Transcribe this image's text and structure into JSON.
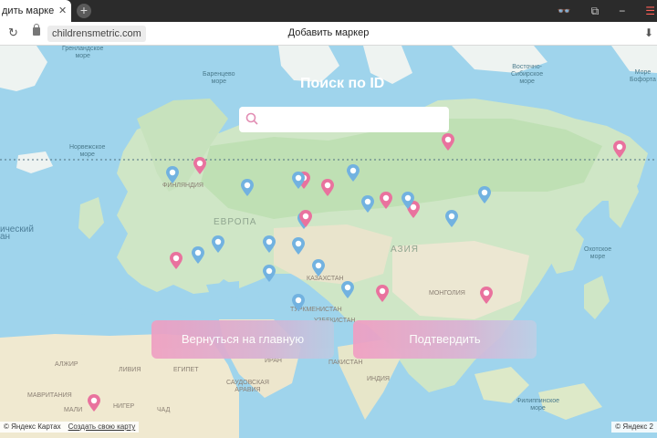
{
  "browser": {
    "tab_title": "дить маркер",
    "tab_close": "✕",
    "new_tab": "+",
    "url": "childrensmetric.com",
    "page_title": "Добавить маркер"
  },
  "search": {
    "title": "Поиск по ID",
    "placeholder": ""
  },
  "buttons": {
    "back": "Вернуться на главную",
    "confirm": "Подтвердить"
  },
  "footer": {
    "yandex_left": "© Яндекс Картах",
    "create_map": "Создать свою карту",
    "yandex_right": "© Яндекс 2"
  },
  "map_labels": {
    "barents": "Баренцево\nморе",
    "greenland": "Гренландское\nморе",
    "norwegian": "Норвежское\nморе",
    "europe": "ЕВРОПА",
    "asia": "АЗИЯ",
    "atlantic": "ический\nан",
    "okhotsk": "Охотское\nморе",
    "beaufort": "Море\nБофорта",
    "east_siberian": "Восточно-\nСибирское\nморе",
    "philippine": "Филиппинское\nморе",
    "kazakhstan": "КАЗАХСТАН",
    "mongolia": "МОНГОЛИЯ",
    "iran": "ИРАН",
    "egypt": "ЕГИПЕТ",
    "algeria": "АЛЖИР",
    "libya": "ЛИВИЯ",
    "mali": "МАЛИ",
    "niger": "НИГЕР",
    "chad": "ЧАД",
    "saudi": "САУДОВСКАЯ\nАРАВИЯ",
    "mauritania": "МАВРИТАНИЯ",
    "finland": "ФИНЛЯНДИЯ",
    "pakistan": "ПАКИСТАН",
    "india": "ИНДИЯ",
    "turkmenistan": "ТУРКМЕНИСТАН",
    "uzbekistan": "УЗБЕКИСТАН"
  },
  "colors": {
    "pin_pink": "#e9729e",
    "pin_blue": "#72b2e0",
    "water": "#9fd4ec"
  },
  "markers": [
    {
      "color": "pink"
    },
    {
      "color": "blue"
    },
    {
      "color": "blue"
    },
    {
      "color": "pink"
    },
    {
      "color": "pink"
    },
    {
      "color": "blue"
    },
    {
      "color": "blue"
    },
    {
      "color": "pink"
    },
    {
      "color": "pink"
    },
    {
      "color": "blue"
    },
    {
      "color": "blue"
    },
    {
      "color": "pink"
    },
    {
      "color": "blue"
    },
    {
      "color": "pink"
    },
    {
      "color": "blue"
    },
    {
      "color": "blue"
    },
    {
      "color": "blue"
    },
    {
      "color": "blue"
    },
    {
      "color": "blue"
    },
    {
      "color": "blue"
    },
    {
      "color": "blue"
    },
    {
      "color": "pink"
    },
    {
      "color": "pink"
    },
    {
      "color": "blue"
    },
    {
      "color": "pink"
    },
    {
      "color": "blue"
    },
    {
      "color": "blue"
    },
    {
      "color": "pink"
    },
    {
      "color": "pink"
    }
  ]
}
